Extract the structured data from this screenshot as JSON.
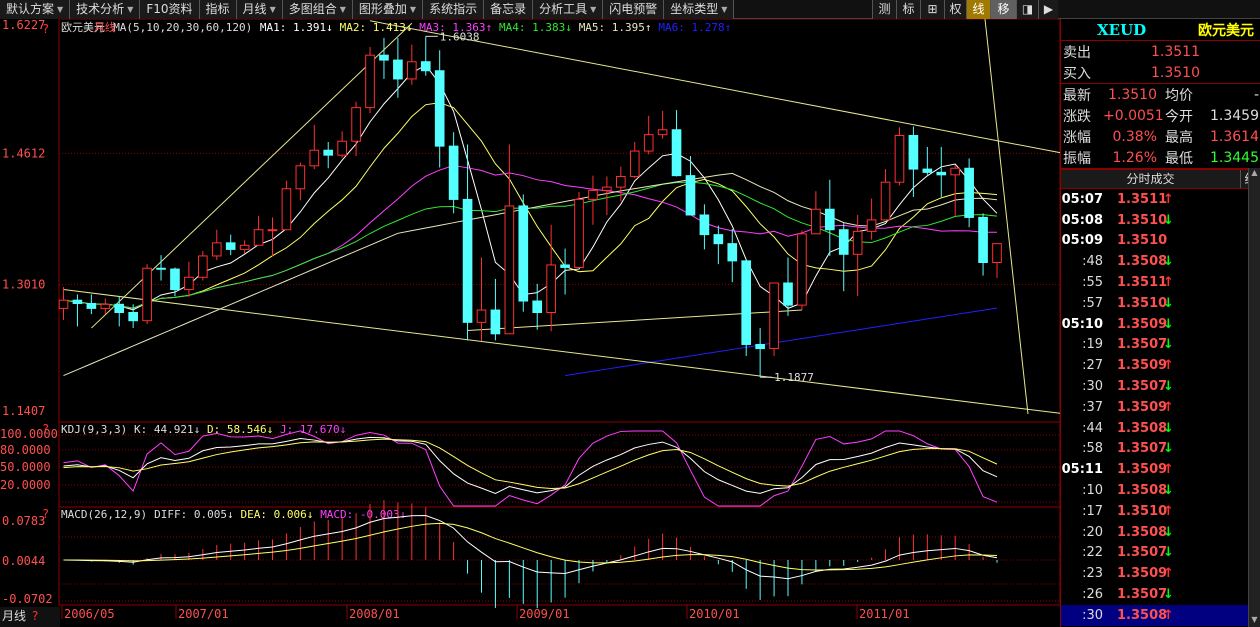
{
  "toolbar": {
    "items": [
      "默认方案",
      "技术分析",
      "F10资料",
      "指标",
      "月线",
      "多图组合",
      "图形叠加",
      "系统指示",
      "备忘录",
      "分析工具",
      "闪电预警",
      "坐标类型"
    ],
    "dropdown_flags": [
      true,
      true,
      false,
      false,
      true,
      true,
      true,
      false,
      false,
      true,
      false,
      true
    ],
    "right_items": [
      "测",
      "标",
      "⊞",
      "权",
      "线",
      "移",
      "◨",
      "▶"
    ]
  },
  "chart_header": {
    "name": "欧元美元",
    "period": "月线",
    "ma_params": "MA(5,10,20,30,60,120)",
    "ma1": "MA1: 1.391↓",
    "ma2": "MA2: 1.413↓",
    "ma3": "MA3: 1.363↑",
    "ma4": "MA4: 1.383↓",
    "ma5": "MA5: 1.395↑",
    "ma6": "MA6: 1.278↑"
  },
  "kdj_header": {
    "params": "KDJ(9,3,3)",
    "k": "K: 44.921↓",
    "d": "D: 58.546↓",
    "j": "J: 17.670↓"
  },
  "macd_header": {
    "params": "MACD(26,12,9)",
    "diff": "DIFF: 0.005↓",
    "dea": "DEA: 0.006↓",
    "macd": "MACD: -0.003↓"
  },
  "y_axis_main": [
    "1.6227",
    "1.4612",
    "1.3010",
    "1.1407"
  ],
  "y_axis_kdj": [
    "100.0000",
    "80.0000",
    "50.0000",
    "20.0000"
  ],
  "y_axis_macd": [
    "0.0783",
    "0.0044",
    "-0.0702"
  ],
  "x_axis": [
    "2006/05",
    "2007/01",
    "2008/01",
    "2009/01",
    "2010/01",
    "2011/01"
  ],
  "bottom_period_label": "月线",
  "annotations": {
    "high": "1.6038",
    "low": "1.1877"
  },
  "colors": {
    "up": "#ff3030",
    "down": "#54ffff",
    "ma1": "#ffffff",
    "ma2": "#ffff66",
    "ma3": "#ff40ff",
    "ma4": "#30e830",
    "ma5": "#e8e8c0",
    "ma6": "#2020ff",
    "trend": "#e8e890"
  },
  "quote": {
    "code": "XEUD",
    "name": "欧元美元",
    "sell_label": "卖出",
    "sell": "1.3511",
    "buy_label": "买入",
    "buy": "1.3510",
    "rows": [
      {
        "a": "最新",
        "b": "1.3510",
        "c": "均价",
        "d": "-",
        "dcolor": "#ddd"
      },
      {
        "a": "涨跌",
        "b": "+0.0051",
        "c": "今开",
        "d": "1.3459",
        "dcolor": "#ddd"
      },
      {
        "a": "涨幅",
        "b": "0.38%",
        "c": "最高",
        "d": "1.3614",
        "dcolor": "#ff5050"
      },
      {
        "a": "振幅",
        "b": "1.26%",
        "c": "最低",
        "d": "1.3445",
        "dcolor": "#30ff30"
      }
    ]
  },
  "ticks": {
    "title": "分时成交",
    "btn": "细",
    "rows": [
      {
        "t": "05:07",
        "p": "1.3511",
        "d": "up",
        "bold": true
      },
      {
        "t": "05:08",
        "p": "1.3510",
        "d": "dn",
        "bold": true
      },
      {
        "t": "05:09",
        "p": "1.3510",
        "d": "",
        "bold": true
      },
      {
        "t": ":48",
        "p": "1.3508",
        "d": "dn"
      },
      {
        "t": ":55",
        "p": "1.3511",
        "d": "up"
      },
      {
        "t": ":57",
        "p": "1.3510",
        "d": "dn"
      },
      {
        "t": "05:10",
        "p": "1.3509",
        "d": "dn",
        "bold": true
      },
      {
        "t": ":19",
        "p": "1.3507",
        "d": "dn"
      },
      {
        "t": ":27",
        "p": "1.3509",
        "d": "up"
      },
      {
        "t": ":30",
        "p": "1.3507",
        "d": "dn"
      },
      {
        "t": ":37",
        "p": "1.3509",
        "d": "up"
      },
      {
        "t": ":44",
        "p": "1.3508",
        "d": "dn"
      },
      {
        "t": ":58",
        "p": "1.3507",
        "d": "dn"
      },
      {
        "t": "05:11",
        "p": "1.3509",
        "d": "up",
        "bold": true
      },
      {
        "t": ":10",
        "p": "1.3508",
        "d": "dn"
      },
      {
        "t": ":17",
        "p": "1.3510",
        "d": "up"
      },
      {
        "t": ":20",
        "p": "1.3508",
        "d": "dn"
      },
      {
        "t": ":22",
        "p": "1.3507",
        "d": "dn"
      },
      {
        "t": ":23",
        "p": "1.3509",
        "d": "up"
      },
      {
        "t": ":26",
        "p": "1.3507",
        "d": "dn"
      },
      {
        "t": ":30",
        "p": "1.3508",
        "d": "up",
        "sel": true
      }
    ]
  },
  "chart_data": {
    "type": "candlestick",
    "title": "欧元美元 月线",
    "x_start": "2006-05",
    "interval": "monthly",
    "ylim": [
      1.1407,
      1.6227
    ],
    "ohlc": [
      [
        1.272,
        1.298,
        1.258,
        1.282
      ],
      [
        1.282,
        1.289,
        1.25,
        1.278
      ],
      [
        1.278,
        1.289,
        1.265,
        1.272
      ],
      [
        1.272,
        1.284,
        1.265,
        1.277
      ],
      [
        1.277,
        1.287,
        1.25,
        1.267
      ],
      [
        1.267,
        1.277,
        1.248,
        1.257
      ],
      [
        1.257,
        1.326,
        1.253,
        1.321
      ],
      [
        1.321,
        1.337,
        1.306,
        1.32
      ],
      [
        1.32,
        1.322,
        1.287,
        1.295
      ],
      [
        1.295,
        1.329,
        1.286,
        1.31
      ],
      [
        1.31,
        1.342,
        1.306,
        1.336
      ],
      [
        1.336,
        1.368,
        1.331,
        1.352
      ],
      [
        1.352,
        1.362,
        1.337,
        1.344
      ],
      [
        1.344,
        1.355,
        1.339,
        1.349
      ],
      [
        1.349,
        1.385,
        1.35,
        1.368
      ],
      [
        1.368,
        1.383,
        1.336,
        1.368
      ],
      [
        1.368,
        1.428,
        1.368,
        1.418
      ],
      [
        1.418,
        1.45,
        1.404,
        1.446
      ],
      [
        1.446,
        1.496,
        1.442,
        1.465
      ],
      [
        1.465,
        1.475,
        1.443,
        1.459
      ],
      [
        1.459,
        1.488,
        1.456,
        1.476
      ],
      [
        1.476,
        1.524,
        1.458,
        1.517
      ],
      [
        1.517,
        1.591,
        1.51,
        1.581
      ],
      [
        1.581,
        1.602,
        1.552,
        1.575
      ],
      [
        1.575,
        1.602,
        1.529,
        1.552
      ],
      [
        1.552,
        1.594,
        1.545,
        1.573
      ],
      [
        1.573,
        1.604,
        1.556,
        1.562
      ],
      [
        1.562,
        1.587,
        1.444,
        1.47
      ],
      [
        1.47,
        1.487,
        1.388,
        1.405
      ],
      [
        1.405,
        1.472,
        1.233,
        1.255
      ],
      [
        1.255,
        1.334,
        1.232,
        1.27
      ],
      [
        1.27,
        1.308,
        1.233,
        1.241
      ],
      [
        1.241,
        1.472,
        1.252,
        1.397
      ],
      [
        1.397,
        1.411,
        1.268,
        1.281
      ],
      [
        1.281,
        1.302,
        1.246,
        1.267
      ],
      [
        1.267,
        1.374,
        1.244,
        1.325
      ],
      [
        1.325,
        1.345,
        1.289,
        1.322
      ],
      [
        1.322,
        1.414,
        1.321,
        1.405
      ],
      [
        1.405,
        1.434,
        1.374,
        1.416
      ],
      [
        1.416,
        1.433,
        1.386,
        1.42
      ],
      [
        1.42,
        1.445,
        1.403,
        1.433
      ],
      [
        1.433,
        1.475,
        1.431,
        1.464
      ],
      [
        1.464,
        1.507,
        1.46,
        1.484
      ],
      [
        1.484,
        1.513,
        1.479,
        1.49
      ],
      [
        1.49,
        1.514,
        1.433,
        1.434
      ],
      [
        1.434,
        1.458,
        1.386,
        1.386
      ],
      [
        1.386,
        1.399,
        1.344,
        1.362
      ],
      [
        1.362,
        1.373,
        1.326,
        1.351
      ],
      [
        1.351,
        1.369,
        1.304,
        1.33
      ],
      [
        1.33,
        1.331,
        1.214,
        1.228
      ],
      [
        1.228,
        1.248,
        1.188,
        1.223
      ],
      [
        1.223,
        1.303,
        1.214,
        1.303
      ],
      [
        1.303,
        1.334,
        1.263,
        1.276
      ],
      [
        1.276,
        1.367,
        1.27,
        1.363
      ],
      [
        1.363,
        1.415,
        1.365,
        1.393
      ],
      [
        1.393,
        1.429,
        1.336,
        1.368
      ],
      [
        1.368,
        1.376,
        1.293,
        1.338
      ],
      [
        1.338,
        1.386,
        1.287,
        1.366
      ],
      [
        1.366,
        1.406,
        1.356,
        1.38
      ],
      [
        1.38,
        1.442,
        1.381,
        1.426
      ],
      [
        1.426,
        1.493,
        1.422,
        1.483
      ],
      [
        1.483,
        1.494,
        1.408,
        1.442
      ],
      [
        1.442,
        1.469,
        1.435,
        1.438
      ],
      [
        1.438,
        1.469,
        1.408,
        1.435
      ],
      [
        1.435,
        1.447,
        1.385,
        1.443
      ],
      [
        1.443,
        1.455,
        1.371,
        1.383
      ],
      [
        1.383,
        1.388,
        1.312,
        1.328
      ],
      [
        1.328,
        1.346,
        1.309,
        1.351
      ]
    ],
    "high_label": 1.6038,
    "low_label": 1.1877
  }
}
